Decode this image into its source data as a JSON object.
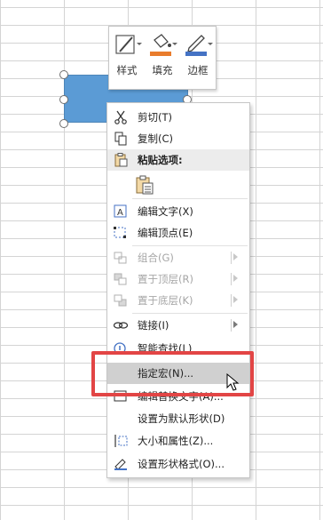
{
  "mini_toolbar": {
    "style_label": "样式",
    "fill_label": "填充",
    "border_label": "边框",
    "fill_color": "#e97c2c",
    "border_color": "#4472c4"
  },
  "shape": {
    "fill_color": "#5b9bd5"
  },
  "context_menu": {
    "items": [
      {
        "label": "剪切(T)",
        "icon": "scissors-icon",
        "enabled": true
      },
      {
        "label": "复制(C)",
        "icon": "copy-icon",
        "enabled": true
      },
      {
        "label": "粘贴选项:",
        "icon": "paste-icon",
        "enabled": true
      },
      {
        "label": "编辑文字(X)",
        "icon": "edit-text-icon",
        "enabled": true
      },
      {
        "label": "编辑顶点(E)",
        "icon": "edit-points-icon",
        "enabled": true
      },
      {
        "label": "组合(G)",
        "icon": "group-icon",
        "enabled": false
      },
      {
        "label": "置于顶层(R)",
        "icon": "bring-front-icon",
        "enabled": false
      },
      {
        "label": "置于底层(K)",
        "icon": "send-back-icon",
        "enabled": false
      },
      {
        "label": "链接(I)",
        "icon": "link-icon",
        "enabled": true
      },
      {
        "label": "智能查找(L)",
        "icon": "smart-lookup-icon",
        "enabled": true
      },
      {
        "label": "指定宏(N)...",
        "icon": "",
        "enabled": true
      },
      {
        "label": "编辑替换文字(A)...",
        "icon": "alt-text-icon",
        "enabled": true
      },
      {
        "label": "设置为默认形状(D)",
        "icon": "",
        "enabled": true
      },
      {
        "label": "大小和属性(Z)...",
        "icon": "size-properties-icon",
        "enabled": true
      },
      {
        "label": "设置形状格式(O)...",
        "icon": "format-shape-icon",
        "enabled": true
      }
    ]
  },
  "highlight_color": "#e24545"
}
